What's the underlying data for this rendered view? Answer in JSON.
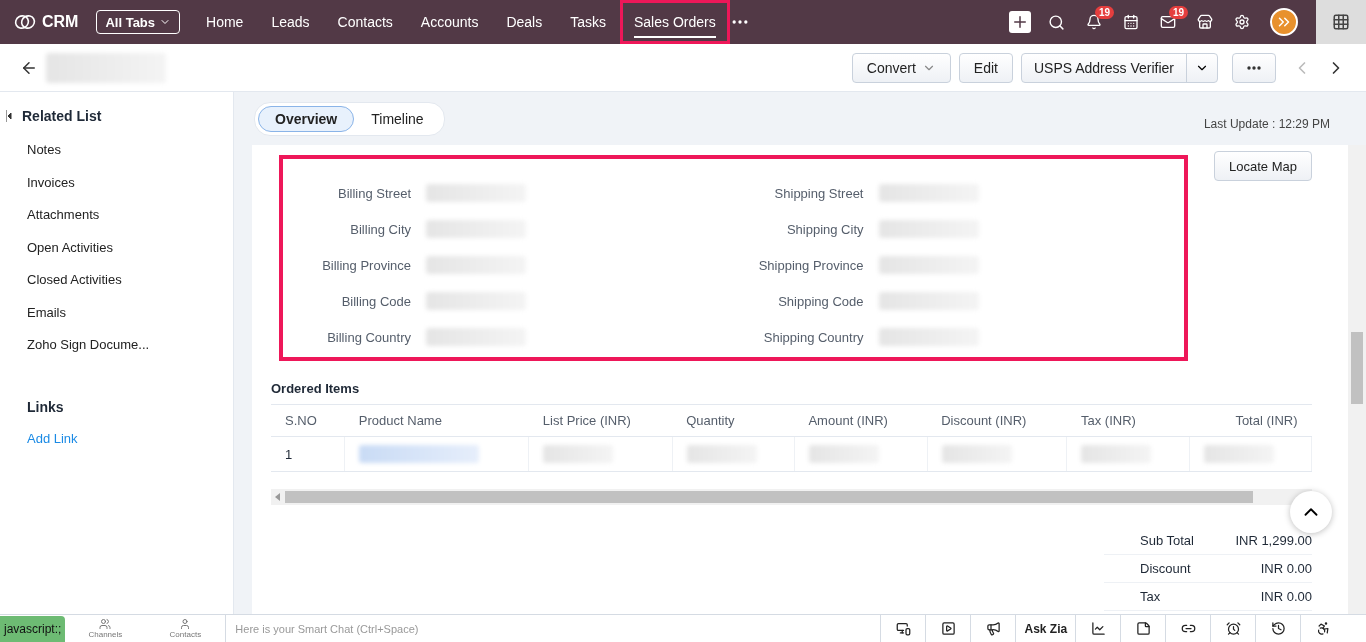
{
  "topbar": {
    "app_name": "CRM",
    "all_tabs": "All Tabs",
    "nav": [
      {
        "label": "Home",
        "selected": false,
        "highlighted": false
      },
      {
        "label": "Leads",
        "selected": false,
        "highlighted": false
      },
      {
        "label": "Contacts",
        "selected": false,
        "highlighted": false
      },
      {
        "label": "Accounts",
        "selected": false,
        "highlighted": false
      },
      {
        "label": "Deals",
        "selected": false,
        "highlighted": false
      },
      {
        "label": "Tasks",
        "selected": false,
        "highlighted": false
      },
      {
        "label": "Sales Orders",
        "selected": true,
        "highlighted": true
      }
    ],
    "notification_count": "19",
    "mail_count": "19"
  },
  "record_bar": {
    "title_redacted": true,
    "buttons": [
      {
        "label": "Convert",
        "kind": "dropdown"
      },
      {
        "label": "Edit",
        "kind": "plain"
      },
      {
        "label": "USPS Address Verifier",
        "kind": "split"
      }
    ]
  },
  "sidebar": {
    "related_title": "Related List",
    "items": [
      "Notes",
      "Invoices",
      "Attachments",
      "Open Activities",
      "Closed Activities",
      "Emails",
      "Zoho Sign Docume..."
    ],
    "links_title": "Links",
    "add_link": "Add Link"
  },
  "view_tabs": [
    {
      "label": "Overview",
      "selected": true
    },
    {
      "label": "Timeline",
      "selected": false
    }
  ],
  "last_update": "Last Update : 12:29 PM",
  "locate_map": "Locate Map",
  "address": {
    "highlighted": true,
    "columns": [
      [
        {
          "label": "Billing Street",
          "redacted": true
        },
        {
          "label": "Billing City",
          "redacted": true
        },
        {
          "label": "Billing Province",
          "redacted": true
        },
        {
          "label": "Billing Code",
          "redacted": true
        },
        {
          "label": "Billing Country",
          "redacted": true
        }
      ],
      [
        {
          "label": "Shipping Street",
          "redacted": true
        },
        {
          "label": "Shipping City",
          "redacted": true
        },
        {
          "label": "Shipping Province",
          "redacted": true
        },
        {
          "label": "Shipping Code",
          "redacted": true
        },
        {
          "label": "Shipping Country",
          "redacted": true
        }
      ]
    ]
  },
  "ordered_items": {
    "title": "Ordered Items",
    "columns": [
      "S.NO",
      "Product Name",
      "List Price (INR)",
      "Quantity",
      "Amount (INR)",
      "Discount (INR)",
      "Tax (INR)",
      "Total (INR)"
    ],
    "rows": [
      {
        "cells": [
          {
            "kind": "text",
            "text": "1"
          },
          {
            "kind": "redacted-link"
          },
          {
            "kind": "redacted"
          },
          {
            "kind": "redacted"
          },
          {
            "kind": "redacted"
          },
          {
            "kind": "redacted"
          },
          {
            "kind": "redacted"
          },
          {
            "kind": "redacted"
          }
        ]
      }
    ]
  },
  "totals": [
    {
      "label": "Sub Total",
      "value": "INR 1,299.00"
    },
    {
      "label": "Discount",
      "value": "INR 0.00"
    },
    {
      "label": "Tax",
      "value": "INR 0.00"
    }
  ],
  "bottom_bar": {
    "status_url": "javascript:;",
    "channels": "Channels",
    "contacts": "Contacts",
    "chat_placeholder": "Here is your Smart Chat (Ctrl+Space)",
    "zia": "Ask Zia"
  }
}
